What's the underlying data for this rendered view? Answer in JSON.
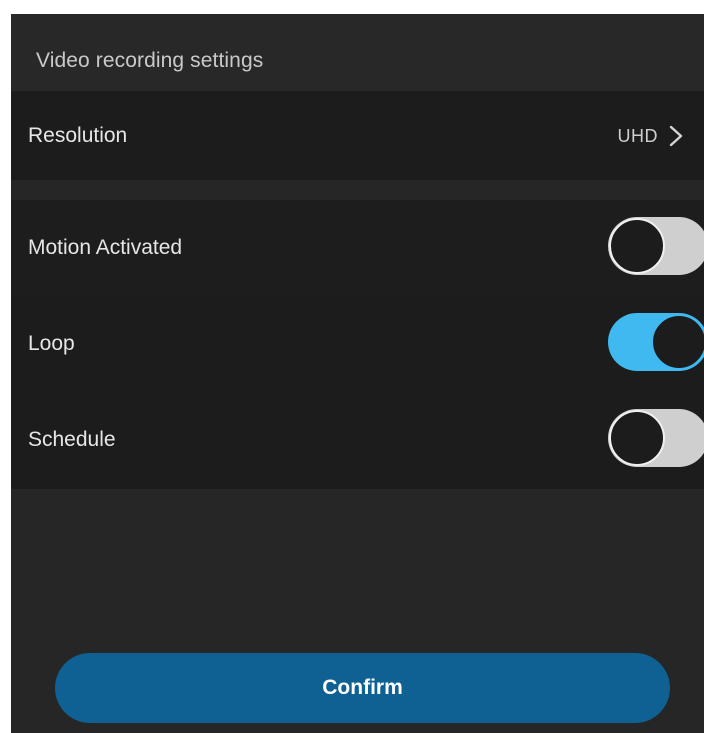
{
  "header": {
    "title": "Video recording settings"
  },
  "resolution": {
    "label": "Resolution",
    "value": "UHD",
    "icon": "chevron-right-icon"
  },
  "toggles": [
    {
      "label": "Motion Activated",
      "on": false
    },
    {
      "label": "Loop",
      "on": true
    },
    {
      "label": "Schedule",
      "on": false
    }
  ],
  "confirm": {
    "label": "Confirm"
  },
  "colors": {
    "background": "#262626",
    "row_background": "#1c1c1c",
    "toggle_on": "#3fb9ef",
    "toggle_off": "#cfcfcf",
    "confirm_button": "#0f6194"
  }
}
